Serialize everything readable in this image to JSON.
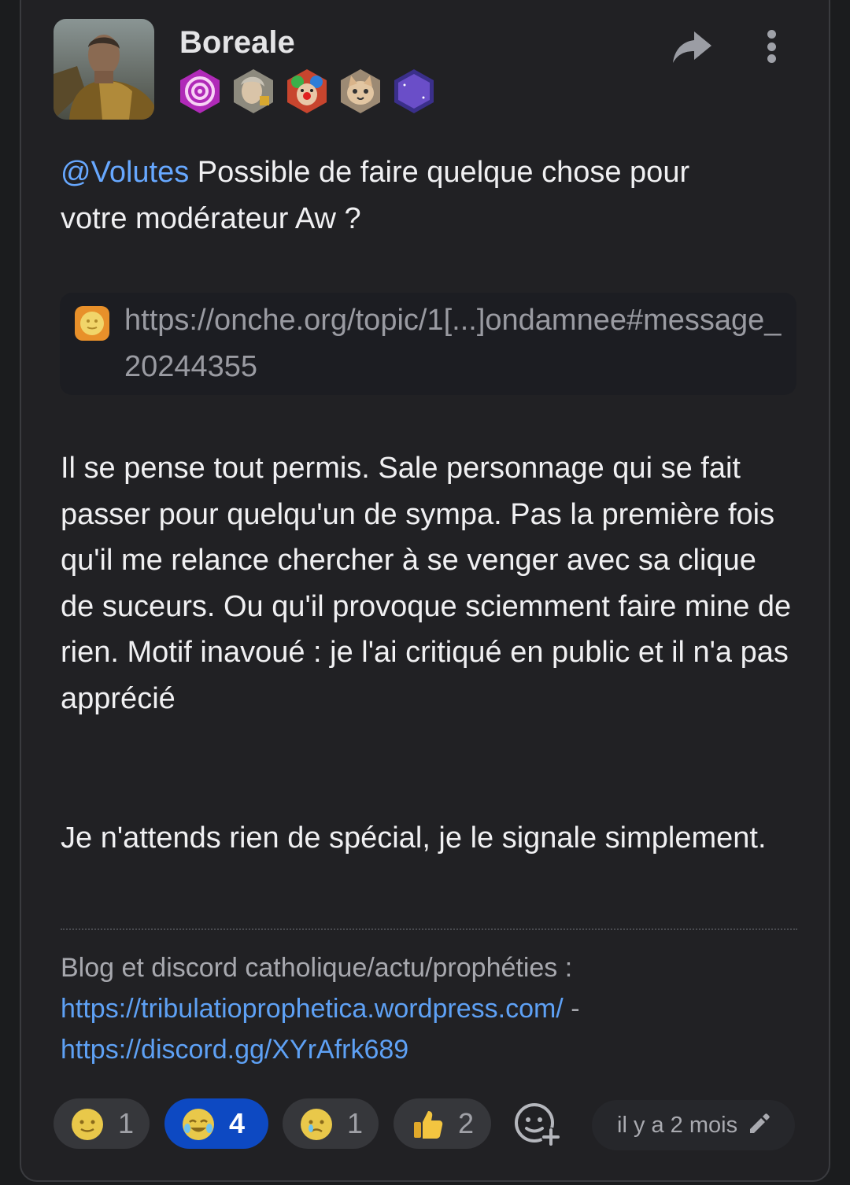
{
  "post": {
    "username": "Boreale",
    "badges": [
      "spiral-badge",
      "portrait-badge",
      "clown-badge",
      "cat-badge",
      "moon-badge"
    ],
    "body": {
      "mention": "@Volutes",
      "line1_rest": " Possible de faire quelque chose pour",
      "line2": "votre modérateur Aw ?",
      "link_url": "https://onche.org/topic/1[...]ondamnee#message_20244355",
      "paragraph2": "Il se pense tout permis. Sale personnage qui se fait passer pour quelqu'un de sympa. Pas la première fois qu'il me relance chercher à se venger avec sa clique de suceurs. Ou qu'il provoque sciemment faire mine de rien. Motif inavoué : je l'ai critiqué en public et il n'a pas apprécié",
      "paragraph3": "Je n'attends rien de spécial, je le signale simplement."
    },
    "signature": {
      "text": "Blog et discord catholique/actu/prophéties :",
      "link1": "https://tribulatioprophetica.wordpress.com/",
      "separator": " -",
      "link2": "https://discord.gg/XYrAfrk689"
    },
    "reactions": [
      {
        "emoji": "smiley-yellow-icon",
        "count": "1",
        "active": false
      },
      {
        "emoji": "crying-laughing-icon",
        "count": "4",
        "active": true
      },
      {
        "emoji": "crying-icon",
        "count": "1",
        "active": false
      },
      {
        "emoji": "thumbs-up-icon",
        "count": "2",
        "active": false
      }
    ],
    "timestamp": "il y a 2 mois",
    "colors": {
      "accent": "#0d49c2",
      "link": "#5ea1f5",
      "mention": "#67a8ff",
      "card": "#212124"
    }
  }
}
